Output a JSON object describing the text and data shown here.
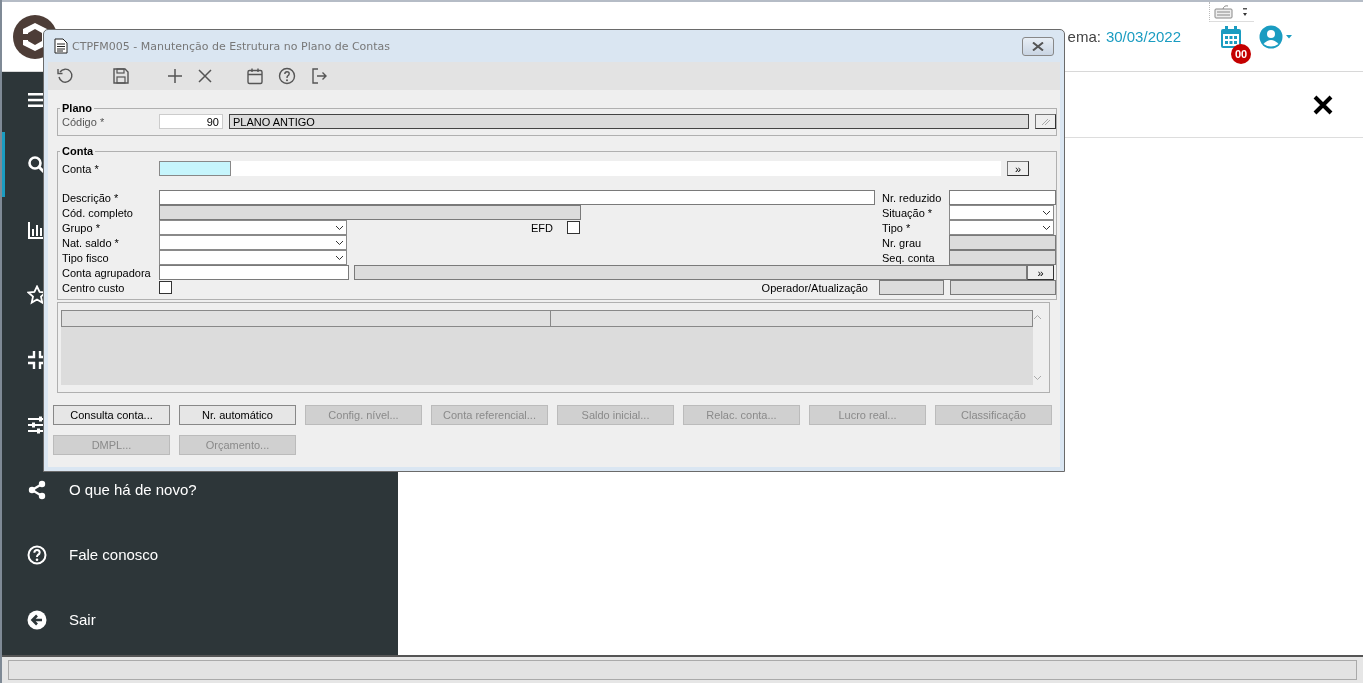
{
  "header": {
    "date_label": "ema:",
    "date": "30/03/2022",
    "badge": "00"
  },
  "sidebar": {
    "items": [
      {
        "kind": "menu",
        "selected": false
      },
      {
        "kind": "search",
        "selected": true
      },
      {
        "kind": "chart",
        "selected": false
      },
      {
        "kind": "star",
        "selected": false
      },
      {
        "kind": "compress",
        "selected": false
      },
      {
        "kind": "sliders",
        "selected": false
      },
      {
        "kind": "share",
        "label": "O que há de novo?",
        "selected": false
      },
      {
        "kind": "help",
        "label": "Fale conosco",
        "selected": false
      },
      {
        "kind": "exit",
        "label": "Sair",
        "selected": false
      }
    ]
  },
  "dialog": {
    "title": "CTPFM005 - Manutenção de Estrutura no Plano de Contas",
    "toolbar": [
      {
        "kind": "undo"
      },
      {
        "kind": "save"
      },
      {
        "kind": "add"
      },
      {
        "kind": "delete"
      },
      {
        "kind": "calendar"
      },
      {
        "kind": "help"
      },
      {
        "kind": "exit"
      }
    ],
    "plano": {
      "legend": "Plano",
      "label": "Código *",
      "code": "90",
      "name": "PLANO ANTIGO"
    },
    "conta": {
      "legend": "Conta",
      "conta_label": "Conta *",
      "conta_more": "»",
      "descricao_label": "Descrição *",
      "nr_reduzido_label": "Nr. reduzido",
      "cod_completo_label": "Cód. completo",
      "situacao_label": "Situação *",
      "grupo_label": "Grupo *",
      "efd_label": "EFD",
      "efd_checked": false,
      "tipo_label": "Tipo *",
      "nat_saldo_label": "Nat. saldo *",
      "nr_grau_label": "Nr. grau",
      "tipo_fisco_label": "Tipo fisco",
      "seq_conta_label": "Seq. conta",
      "conta_agrupadora_label": "Conta agrupadora",
      "agrupadora_more": "»",
      "centro_custo_label": "Centro custo",
      "centro_custo_checked": false,
      "operador_label": "Operador/Atualização"
    },
    "buttons": [
      {
        "label": "Consulta conta...",
        "disabled": false
      },
      {
        "label": "Nr. automático",
        "disabled": false
      },
      {
        "label": "Config. nível...",
        "disabled": true
      },
      {
        "label": "Conta referencial...",
        "disabled": true
      },
      {
        "label": "Saldo inicial...",
        "disabled": true
      },
      {
        "label": "Relac. conta...",
        "disabled": true
      },
      {
        "label": "Lucro real...",
        "disabled": true
      },
      {
        "label": "Classificação",
        "disabled": true
      },
      {
        "label": "DMPL...",
        "disabled": true
      },
      {
        "label": "Orçamento...",
        "disabled": true
      }
    ]
  }
}
